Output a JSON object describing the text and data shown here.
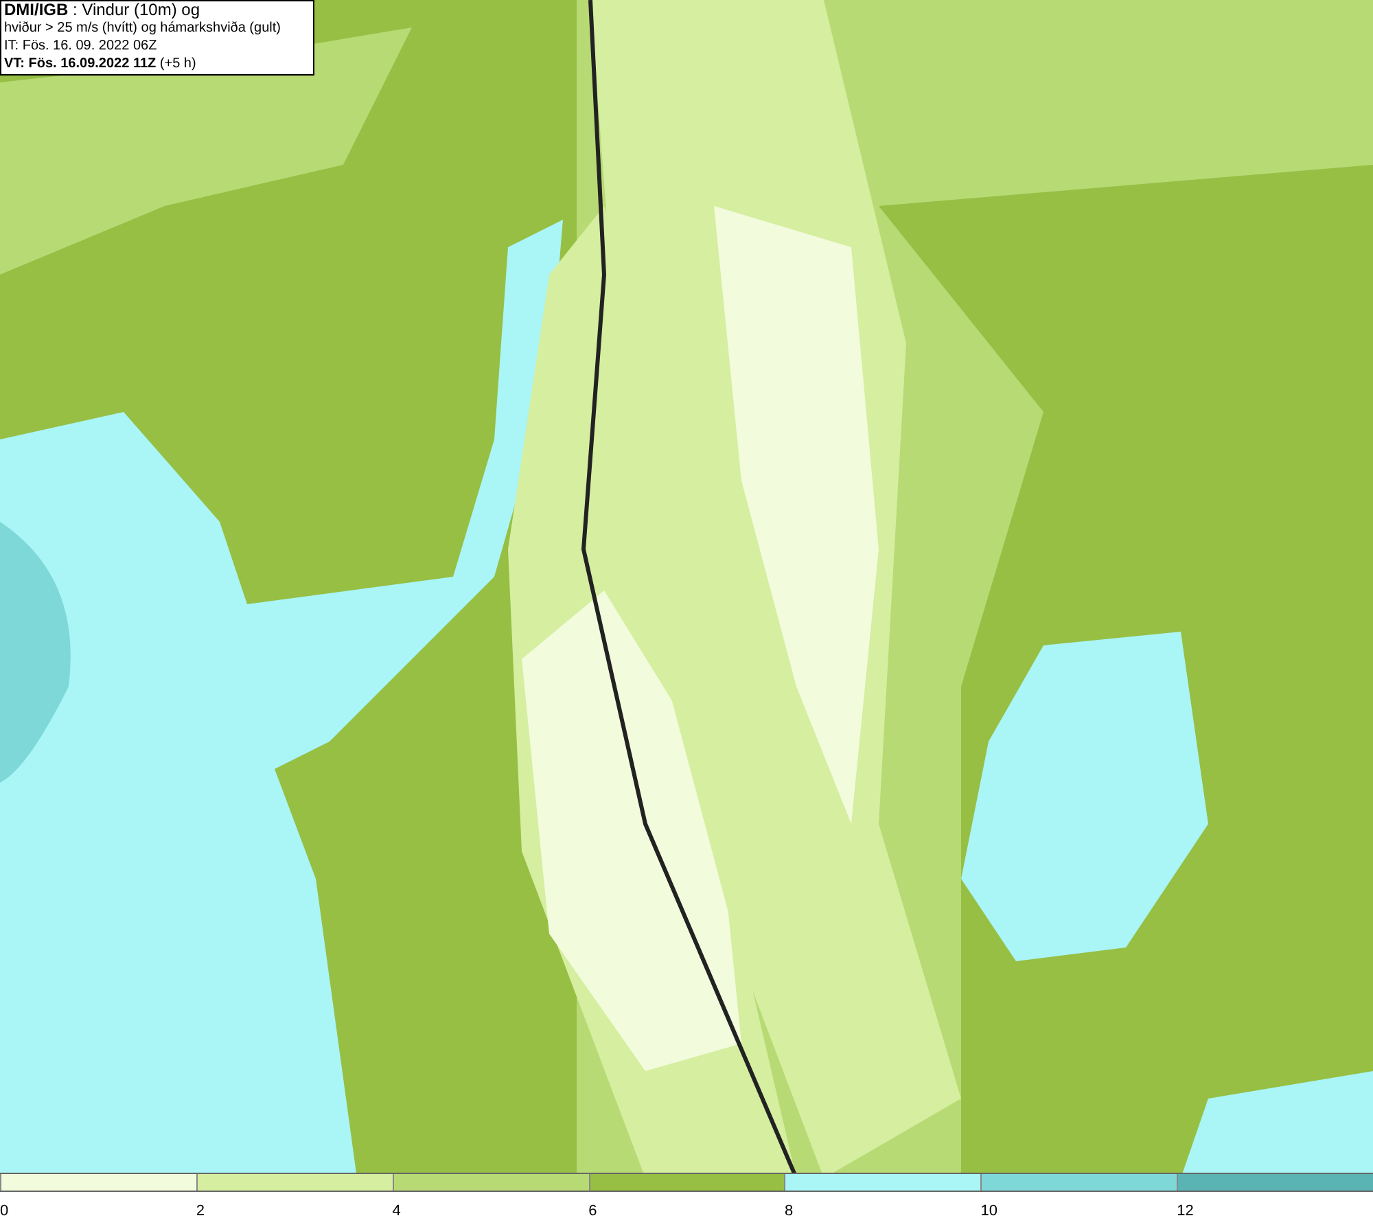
{
  "header": {
    "lines": [
      "**DMI/IGB** : Vindur (10m) og",
      "hviður > 25 m/s (hvítt) og hámarkshviða (gult)",
      "IT: Fös. 16. 09. 2022 06Z",
      "**VT: Fös. 16.09.2022 11Z** (+5 h)"
    ]
  },
  "legend": [
    {
      "label": "0",
      "color": "#f2fbdc"
    },
    {
      "label": "2",
      "color": "#d5eea0"
    },
    {
      "label": "4",
      "color": "#b7da74"
    },
    {
      "label": "6",
      "color": "#96bf44"
    },
    {
      "label": "8",
      "color": "#aaf5f5"
    },
    {
      "label": "10",
      "color": "#7fd8d8"
    },
    {
      "label": "12",
      "color": "#5ab4b4"
    }
  ]
}
